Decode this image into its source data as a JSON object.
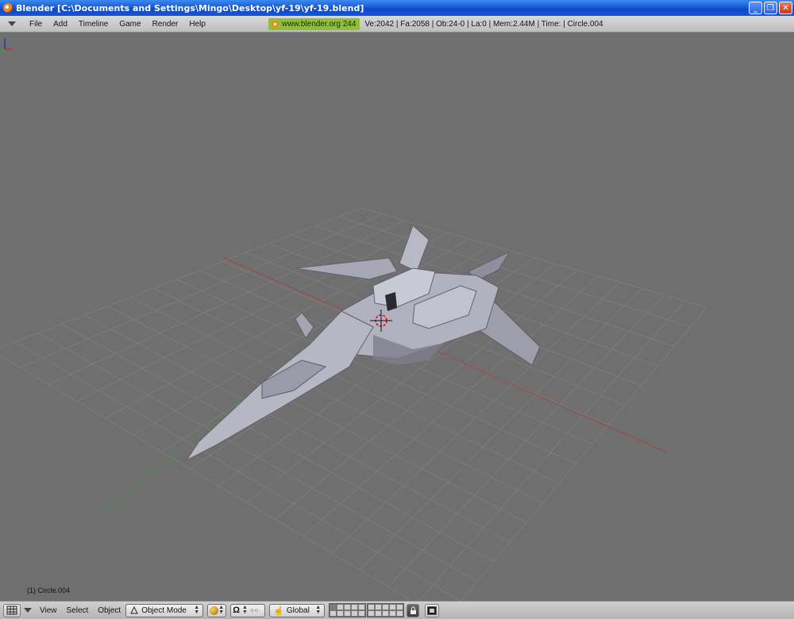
{
  "window": {
    "title": "Blender [C:\\Documents and Settings\\Mingo\\Desktop\\yf-19\\yf-19.blend]",
    "minimize_label": "_",
    "maximize_label": "❐",
    "close_label": "✕"
  },
  "info_header": {
    "menus": [
      "File",
      "Add",
      "Timeline",
      "Game",
      "Render",
      "Help"
    ],
    "site": "www.blender.org 244",
    "stats": "Ve:2042 | Fa:2058 | Ob:24-0 | La:0  | Mem:2.44M  | Time: | Circle.004"
  },
  "viewport": {
    "object_label": "(1) Circle.004",
    "background_color": "#6f6f6f",
    "grid_color": "#7d7d7d",
    "x_axis_color": "#9b4a4a",
    "y_axis_color": "#4a8a4a"
  },
  "view_header": {
    "menus": [
      "View",
      "Select",
      "Object"
    ],
    "mode": "Object Mode",
    "orientation": "Global",
    "view_type_icon": "grid-icon",
    "shading_icon": "solid-shading-icon",
    "pivot_icon": "pivot-icon",
    "manipulator_icon": "hand-icon",
    "lock_icon": "lock-icon",
    "render_icon": "render-icon"
  }
}
